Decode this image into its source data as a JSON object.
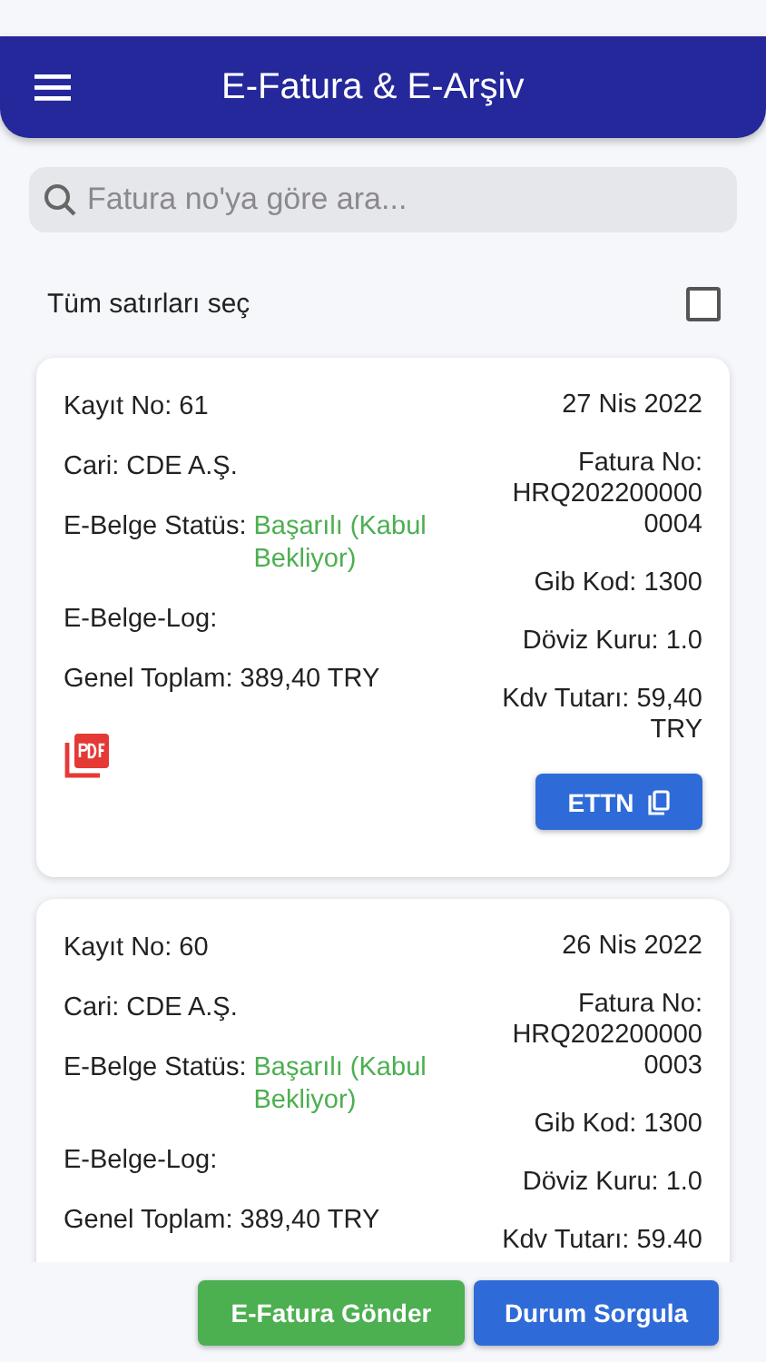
{
  "app_bar": {
    "title": "E-Fatura & E-Arşiv"
  },
  "search": {
    "placeholder": "Fatura no'ya göre ara..."
  },
  "select_all": {
    "label": "Tüm satırları seç",
    "checked": false
  },
  "invoices": [
    {
      "record": "Kayıt No: 61",
      "date": "27 Nis 2022",
      "customer": "Cari: CDE A.Ş.",
      "status_label": "E-Belge Statüs:",
      "status_value": "Başarılı (Kabul Bekliyor)",
      "log": "E-Belge-Log:",
      "total": "Genel Toplam: 389,40 TRY",
      "invoice_no": "Fatura No: HRQ2022000000004",
      "gib_code": "Gib Kod: 1300",
      "exchange_rate": "Döviz Kuru: 1.0",
      "vat": "Kdv Tutarı: 59,40 TRY",
      "ettn_button": "ETTN"
    },
    {
      "record": "Kayıt No: 60",
      "date": "26 Nis 2022",
      "customer": "Cari: CDE A.Ş.",
      "status_label": "E-Belge Statüs:",
      "status_value": "Başarılı (Kabul Bekliyor)",
      "log": "E-Belge-Log:",
      "total": "Genel Toplam: 389,40 TRY",
      "invoice_no": "Fatura No: HRQ2022000000003",
      "gib_code": "Gib Kod: 1300",
      "exchange_rate": "Döviz Kuru: 1.0",
      "vat": "Kdv Tutarı: 59.40"
    }
  ],
  "actions": [
    {
      "label": "E-Fatura Gönder",
      "kind": "send"
    },
    {
      "label": "Durum Sorgula",
      "kind": "query"
    }
  ]
}
